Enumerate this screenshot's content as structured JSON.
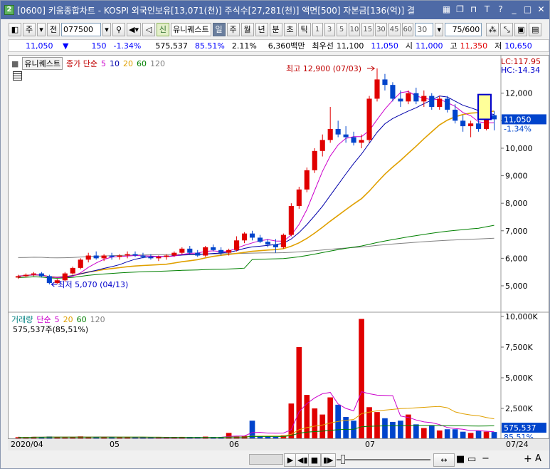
{
  "title": "[0600] 키움종합차트 - KOSPI 외국인보유[13,071(천)] 주식수[27,281(천)] 액면[500] 자본금[136(억)] 결",
  "title_icon": "2",
  "toolbar": {
    "period": "주",
    "prev_label": "전",
    "code": "077500",
    "shin": "신",
    "stock_name": "유니퀘스트",
    "tabs": [
      "일",
      "주",
      "월",
      "년",
      "분",
      "초",
      "틱"
    ],
    "active_tab": "일",
    "numbers": [
      "1",
      "3",
      "5",
      "10",
      "15",
      "30",
      "45",
      "60"
    ],
    "interval": "30",
    "count": "75/600"
  },
  "info": {
    "price": "11,050",
    "change": "150",
    "change_pct": "-1.34%",
    "volume": "575,537",
    "vol_ratio": "85.51%",
    "turnover": "2.11%",
    "amount": "6,360백만",
    "bid_label": "최우선",
    "bid": "11,100",
    "ask": "11,050",
    "open_label": "시",
    "open": "11,000",
    "high_label": "고",
    "high": "11,350",
    "low_label": "저",
    "low": "10,650"
  },
  "price_legend": {
    "name": "유니퀘스트",
    "series": "종가 단순",
    "ma": [
      "5",
      "10",
      "20",
      "60",
      "120"
    ],
    "ma_colors": [
      "#cc00cc",
      "#0000aa",
      "#e0a000",
      "#008000",
      "#808080"
    ]
  },
  "volume_legend": {
    "name": "거래량",
    "series": "단순",
    "ma": [
      "5",
      "20",
      "60",
      "120"
    ],
    "readout": "575,537주(85,51%)"
  },
  "annotations": {
    "lc": "LC:117.95",
    "hc": "HC:-14.34",
    "high": "최고 12,900 (07/03)",
    "low": "최저 5,070 (04/13)",
    "cur_price": "11,050",
    "cur_pct": "-1.34%",
    "vol_cur": "575,537",
    "vol_pct": "85.51%"
  },
  "colors": {
    "up": "#e00000",
    "down": "#0044cc",
    "title": "#4e6aa6"
  },
  "chart_data": [
    {
      "type": "candlestick",
      "title": "",
      "ylim": [
        4300,
        12900
      ],
      "yticks": [
        "12,000",
        "11,000",
        "10,000",
        "9,000",
        "8,000",
        "7,000",
        "6,000",
        "5,000"
      ],
      "ytick_values": [
        12000,
        11000,
        10000,
        9000,
        8000,
        7000,
        6000,
        5000
      ],
      "xlabels": [
        "2020/04",
        "05",
        "06",
        "07",
        "07/24"
      ],
      "candles": [
        [
          5300,
          5400,
          5250,
          5350
        ],
        [
          5350,
          5450,
          5300,
          5400
        ],
        [
          5400,
          5500,
          5350,
          5450
        ],
        [
          5450,
          5500,
          5300,
          5350
        ],
        [
          5350,
          5400,
          5050,
          5100
        ],
        [
          5100,
          5250,
          5070,
          5200
        ],
        [
          5200,
          5500,
          5150,
          5450
        ],
        [
          5450,
          5700,
          5400,
          5650
        ],
        [
          5650,
          6000,
          5600,
          5950
        ],
        [
          5950,
          6200,
          5850,
          6100
        ],
        [
          6100,
          6250,
          5950,
          6000
        ],
        [
          6000,
          6150,
          5900,
          6100
        ],
        [
          6100,
          6200,
          5950,
          6050
        ],
        [
          6050,
          6150,
          5950,
          6100
        ],
        [
          6100,
          6250,
          6000,
          6150
        ],
        [
          6150,
          6250,
          6050,
          6100
        ],
        [
          6100,
          6200,
          6000,
          6050
        ],
        [
          6050,
          6150,
          5950,
          6000
        ],
        [
          6000,
          6100,
          5900,
          6050
        ],
        [
          6050,
          6150,
          5950,
          6100
        ],
        [
          6100,
          6250,
          6050,
          6200
        ],
        [
          6200,
          6400,
          6150,
          6350
        ],
        [
          6350,
          6450,
          6150,
          6200
        ],
        [
          6200,
          6300,
          6050,
          6100
        ],
        [
          6100,
          6450,
          6050,
          6400
        ],
        [
          6400,
          6500,
          6250,
          6300
        ],
        [
          6300,
          6400,
          6100,
          6200
        ],
        [
          6200,
          6350,
          6100,
          6300
        ],
        [
          6300,
          6800,
          6250,
          6650
        ],
        [
          6650,
          6950,
          6550,
          6900
        ],
        [
          6900,
          7000,
          6650,
          6750
        ],
        [
          6750,
          6850,
          6550,
          6600
        ],
        [
          6600,
          6700,
          6400,
          6500
        ],
        [
          6500,
          6700,
          6200,
          6400
        ],
        [
          6400,
          6900,
          6350,
          6850
        ],
        [
          6850,
          8000,
          6800,
          7900
        ],
        [
          7900,
          8600,
          7800,
          8500
        ],
        [
          8500,
          9300,
          8400,
          9200
        ],
        [
          9200,
          10000,
          9100,
          9900
        ],
        [
          9900,
          10500,
          9700,
          10300
        ],
        [
          10300,
          11500,
          10200,
          10700
        ],
        [
          10700,
          11000,
          10400,
          10500
        ],
        [
          10500,
          10800,
          10200,
          10400
        ],
        [
          10400,
          10600,
          10100,
          10200
        ],
        [
          10200,
          10500,
          10000,
          10300
        ],
        [
          10300,
          11900,
          10200,
          11800
        ],
        [
          11800,
          12900,
          11700,
          12500
        ],
        [
          12500,
          12700,
          12100,
          12300
        ],
        [
          12300,
          12400,
          11700,
          11800
        ],
        [
          11800,
          12100,
          11500,
          11700
        ],
        [
          11700,
          12100,
          11600,
          12000
        ],
        [
          12000,
          12200,
          11600,
          11700
        ],
        [
          11700,
          12100,
          11500,
          11900
        ],
        [
          11900,
          12000,
          11400,
          11500
        ],
        [
          11500,
          11900,
          11400,
          11800
        ],
        [
          11800,
          11900,
          11300,
          11400
        ],
        [
          11400,
          11600,
          10900,
          11000
        ],
        [
          11000,
          11200,
          10600,
          10800
        ],
        [
          10800,
          11000,
          10400,
          10900
        ],
        [
          10900,
          11100,
          10600,
          10700
        ],
        [
          10700,
          11300,
          10650,
          11200
        ],
        [
          11200,
          11350,
          10650,
          11050
        ]
      ]
    },
    {
      "type": "bar",
      "title": "",
      "ylim": [
        0,
        10000
      ],
      "yticks": [
        "10,000K",
        "7,500K",
        "5,000K",
        "2,500K"
      ],
      "ytick_values": [
        10000,
        7500,
        5000,
        2500
      ],
      "unit": "K",
      "values": [
        150,
        120,
        180,
        160,
        210,
        140,
        120,
        160,
        220,
        140,
        180,
        160,
        150,
        130,
        150,
        120,
        140,
        110,
        100,
        120,
        130,
        170,
        110,
        100,
        200,
        140,
        170,
        500,
        220,
        260,
        1500,
        260,
        200,
        180,
        310,
        2900,
        7500,
        3600,
        2500,
        2000,
        3400,
        2800,
        1800,
        1500,
        9800,
        2600,
        2200,
        1700,
        1400,
        1500,
        2000,
        1200,
        900,
        1100,
        700,
        800,
        800,
        600,
        500,
        700,
        600,
        575
      ]
    }
  ]
}
